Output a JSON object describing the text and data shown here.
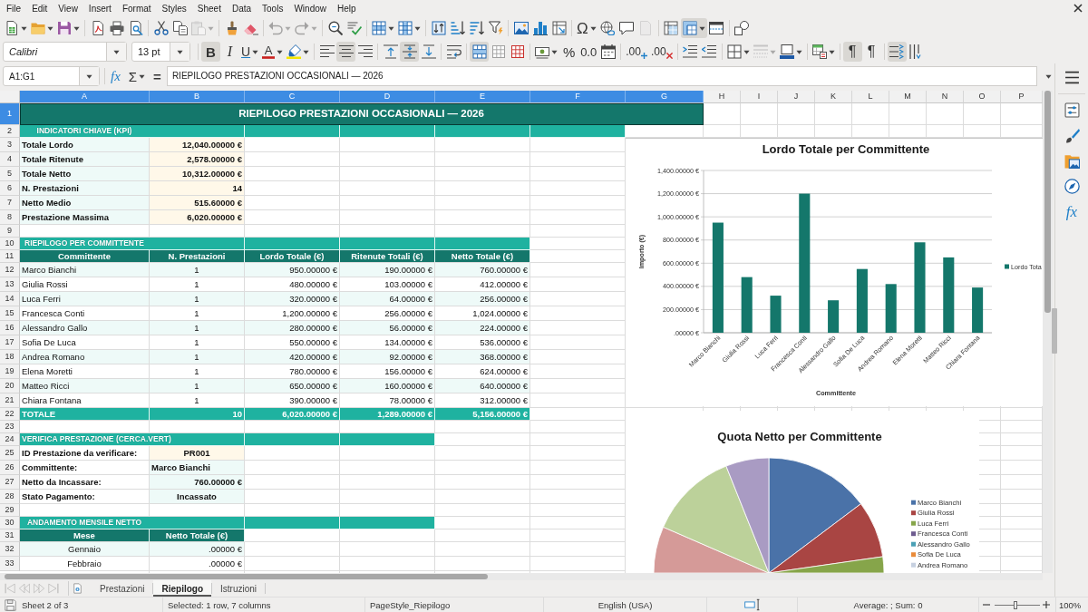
{
  "menu": [
    "File",
    "Edit",
    "View",
    "Insert",
    "Format",
    "Styles",
    "Sheet",
    "Data",
    "Tools",
    "Window",
    "Help"
  ],
  "standard_toolbar": [
    [
      {
        "kind": "new",
        "active": false,
        "disabled": false,
        "dropdown": true
      },
      {
        "kind": "open",
        "active": false,
        "disabled": false,
        "dropdown": true
      },
      {
        "kind": "save",
        "active": false,
        "disabled": false,
        "dropdown": true
      }
    ],
    [
      {
        "kind": "pdf",
        "active": false,
        "disabled": false
      },
      {
        "kind": "print",
        "active": false,
        "disabled": false
      },
      {
        "kind": "preview",
        "active": false,
        "disabled": false
      }
    ],
    [
      {
        "kind": "cut",
        "active": false,
        "disabled": false
      },
      {
        "kind": "copy",
        "active": false,
        "disabled": false
      },
      {
        "kind": "paste",
        "active": false,
        "disabled": true,
        "dropdown": true
      }
    ],
    [
      {
        "kind": "clone",
        "active": false,
        "disabled": false
      },
      {
        "kind": "clear",
        "active": false,
        "disabled": false
      }
    ],
    [
      {
        "kind": "undo",
        "active": false,
        "disabled": true,
        "dropdown": true
      },
      {
        "kind": "redo",
        "active": false,
        "disabled": true,
        "dropdown": true
      }
    ],
    [
      {
        "kind": "find",
        "active": false,
        "disabled": false
      },
      {
        "kind": "spell",
        "active": false,
        "disabled": false
      }
    ],
    [
      {
        "kind": "row",
        "active": false,
        "disabled": false,
        "dropdown": true
      },
      {
        "kind": "column",
        "active": false,
        "disabled": false,
        "dropdown": true
      }
    ],
    [
      {
        "kind": "sort",
        "active": false,
        "disabled": false
      },
      {
        "kind": "sort_ascending",
        "active": false,
        "disabled": false
      },
      {
        "kind": "sort_descending",
        "active": false,
        "disabled": false
      },
      {
        "kind": "autofilter",
        "active": false,
        "disabled": false
      }
    ],
    [
      {
        "kind": "image",
        "active": false,
        "disabled": false
      },
      {
        "kind": "chart",
        "active": false,
        "disabled": false
      },
      {
        "kind": "pivot_table",
        "active": false,
        "disabled": false
      }
    ],
    [
      {
        "kind": "special_character",
        "glyph": "Ω",
        "active": false,
        "disabled": false,
        "dropdown": true
      },
      {
        "kind": "hyperlink",
        "active": false,
        "disabled": false
      },
      {
        "kind": "comment",
        "active": false,
        "disabled": false
      },
      {
        "kind": "headers_footers",
        "active": false,
        "disabled": true
      }
    ],
    [
      {
        "kind": "print_area",
        "active": false,
        "disabled": false
      },
      {
        "kind": "freeze",
        "active": true,
        "disabled": false,
        "dropdown": true
      },
      {
        "kind": "split_window",
        "active": false,
        "disabled": false
      }
    ],
    [
      {
        "kind": "shapes",
        "active": false,
        "disabled": false
      }
    ]
  ],
  "formatting_toolbar": [
    [
      {
        "kind": "font_name",
        "value": "Calibri",
        "disabled": false
      },
      {
        "kind": "font_size",
        "value": "13 pt",
        "disabled": false
      }
    ],
    [
      {
        "kind": "bold",
        "glyph": "B",
        "active": true,
        "disabled": false
      },
      {
        "kind": "italic",
        "glyph": "I",
        "active": false,
        "disabled": false
      },
      {
        "kind": "underline",
        "glyph": "U",
        "active": false,
        "disabled": false,
        "dropdown": true
      },
      {
        "kind": "font_color",
        "glyph": "A",
        "active": false,
        "disabled": false,
        "dropdown": true
      },
      {
        "kind": "highlight",
        "active": false,
        "disabled": false,
        "dropdown": true
      }
    ],
    [
      {
        "kind": "align_left",
        "active": false,
        "disabled": false
      },
      {
        "kind": "align_center",
        "active": true,
        "disabled": false
      },
      {
        "kind": "align_right",
        "active": false,
        "disabled": false
      }
    ],
    [
      {
        "kind": "align_top",
        "active": false,
        "disabled": false
      },
      {
        "kind": "align_middle",
        "active": true,
        "disabled": false
      },
      {
        "kind": "align_bottom",
        "active": false,
        "disabled": false
      }
    ],
    [
      {
        "kind": "wrap",
        "active": false,
        "disabled": false
      }
    ],
    [
      {
        "kind": "merge_center",
        "active": true,
        "disabled": false
      },
      {
        "kind": "unmerge",
        "active": false,
        "disabled": false
      },
      {
        "kind": "merge",
        "active": false,
        "disabled": false
      }
    ],
    [
      {
        "kind": "currency",
        "active": false,
        "disabled": false,
        "dropdown": true
      },
      {
        "kind": "percent",
        "glyph": "%",
        "active": false,
        "disabled": false
      },
      {
        "kind": "number",
        "glyph": "0.0",
        "active": false,
        "disabled": false
      },
      {
        "kind": "date",
        "active": false,
        "disabled": false
      }
    ],
    [
      {
        "kind": "add_decimal",
        "glyph": ".00",
        "active": false,
        "disabled": false
      },
      {
        "kind": "delete_decimal",
        "glyph": ".00",
        "active": false,
        "disabled": false
      }
    ],
    [
      {
        "kind": "indent",
        "active": false,
        "disabled": false
      },
      {
        "kind": "outdent",
        "active": false,
        "disabled": false
      }
    ],
    [
      {
        "kind": "borders",
        "active": false,
        "disabled": false,
        "dropdown": true
      },
      {
        "kind": "border_style",
        "active": false,
        "disabled": true,
        "dropdown": true
      },
      {
        "kind": "border_color",
        "active": false,
        "disabled": false,
        "dropdown": true
      }
    ],
    [
      {
        "kind": "conditional",
        "active": false,
        "disabled": false,
        "dropdown": true
      }
    ],
    [
      {
        "kind": "left_to_right",
        "glyph": "¶",
        "active": true,
        "disabled": false
      },
      {
        "kind": "right_to_left",
        "glyph": "¶",
        "active": false,
        "disabled": false
      }
    ],
    [
      {
        "kind": "text_direction",
        "active": true,
        "disabled": false
      },
      {
        "kind": "vertical_text",
        "active": false,
        "disabled": false
      }
    ]
  ],
  "formula_bar": {
    "name_box": "A1:G1",
    "function_wizard": "fx",
    "sum": "Σ",
    "equals": "=",
    "formula": "RIEPILOGO PRESTAZIONI OCCASIONALI — 2026"
  },
  "columns": [
    {
      "label": "A",
      "selected": true
    },
    {
      "label": "B",
      "selected": true
    },
    {
      "label": "C",
      "selected": true
    },
    {
      "label": "D",
      "selected": true
    },
    {
      "label": "E",
      "selected": true
    },
    {
      "label": "F",
      "selected": true
    },
    {
      "label": "G",
      "selected": true
    },
    {
      "label": "H",
      "selected": false
    },
    {
      "label": "I",
      "selected": false
    },
    {
      "label": "J",
      "selected": false
    },
    {
      "label": "K",
      "selected": false
    },
    {
      "label": "L",
      "selected": false
    },
    {
      "label": "M",
      "selected": false
    },
    {
      "label": "N",
      "selected": false
    },
    {
      "label": "O",
      "selected": false
    },
    {
      "label": "P",
      "selected": false
    }
  ],
  "rows": [
    {
      "label": "1",
      "selected": true,
      "kind": "title",
      "cells": [
        {
          "kind": "title",
          "text": "RIEPILOGO PRESTAZIONI OCCASIONALI — 2026"
        }
      ]
    },
    {
      "label": "2",
      "selected": false,
      "kind": "section",
      "cells": [
        {
          "kind": "section",
          "text": "INDICATORI CHIAVE (KPI)"
        },
        {
          "kind": "section"
        },
        {
          "kind": "section"
        },
        {
          "kind": "section"
        },
        {
          "kind": "section"
        },
        {
          "kind": "section"
        }
      ]
    },
    {
      "label": "3",
      "selected": false,
      "kind": "data",
      "cells": [
        {
          "kind": "kpi_label",
          "text": "Totale Lordo"
        },
        {
          "kind": "kpi_value",
          "text": "12,040.00000 €"
        }
      ]
    },
    {
      "label": "4",
      "selected": false,
      "kind": "data",
      "cells": [
        {
          "kind": "kpi_label",
          "text": "Totale Ritenute"
        },
        {
          "kind": "kpi_value",
          "text": "2,578.00000 €"
        }
      ]
    },
    {
      "label": "5",
      "selected": false,
      "kind": "data",
      "cells": [
        {
          "kind": "kpi_label",
          "text": "Totale Netto"
        },
        {
          "kind": "kpi_value",
          "text": "10,312.00000 €"
        }
      ]
    },
    {
      "label": "6",
      "selected": false,
      "kind": "data",
      "cells": [
        {
          "kind": "kpi_label",
          "text": "N. Prestazioni"
        },
        {
          "kind": "kpi_value",
          "text": "14"
        }
      ]
    },
    {
      "label": "7",
      "selected": false,
      "kind": "data",
      "cells": [
        {
          "kind": "kpi_label",
          "text": "Netto Medio"
        },
        {
          "kind": "kpi_value",
          "text": "515.60000 €"
        }
      ]
    },
    {
      "label": "8",
      "selected": false,
      "kind": "data",
      "cells": [
        {
          "kind": "kpi_label",
          "text": "Prestazione Massima"
        },
        {
          "kind": "kpi_value",
          "text": "6,020.00000 €"
        }
      ]
    },
    {
      "label": "9",
      "selected": false,
      "kind": "blank"
    },
    {
      "label": "10",
      "selected": false,
      "kind": "section",
      "cells": [
        {
          "kind": "section",
          "text": "RIEPILOGO PER COMMITTENTE"
        },
        {
          "kind": "section"
        },
        {
          "kind": "section"
        },
        {
          "kind": "section"
        },
        {
          "kind": "section"
        }
      ]
    },
    {
      "label": "11",
      "selected": false,
      "kind": "header",
      "cells": [
        {
          "kind": "header",
          "text": "Committente"
        },
        {
          "kind": "header",
          "text": "N. Prestazioni"
        },
        {
          "kind": "header",
          "text": "Lordo Totale (€)"
        },
        {
          "kind": "header",
          "text": "Ritenute Totali (€)"
        },
        {
          "kind": "header",
          "text": "Netto Totale (€)"
        }
      ]
    },
    {
      "label": "12",
      "selected": false,
      "kind": "data",
      "shaded": true,
      "cells": [
        {
          "kind": "name",
          "text": "Marco Bianchi"
        },
        {
          "kind": "count",
          "text": "1"
        },
        {
          "kind": "amount",
          "text": "950.00000 €"
        },
        {
          "kind": "amount",
          "text": "190.00000 €"
        },
        {
          "kind": "amount",
          "text": "760.00000 €"
        }
      ]
    },
    {
      "label": "13",
      "selected": false,
      "kind": "data",
      "shaded": false,
      "cells": [
        {
          "kind": "name",
          "text": "Giulia Rossi"
        },
        {
          "kind": "count",
          "text": "1"
        },
        {
          "kind": "amount",
          "text": "480.00000 €"
        },
        {
          "kind": "amount",
          "text": "103.00000 €"
        },
        {
          "kind": "amount",
          "text": "412.00000 €"
        }
      ]
    },
    {
      "label": "14",
      "selected": false,
      "kind": "data",
      "shaded": true,
      "cells": [
        {
          "kind": "name",
          "text": "Luca Ferri"
        },
        {
          "kind": "count",
          "text": "1"
        },
        {
          "kind": "amount",
          "text": "320.00000 €"
        },
        {
          "kind": "amount",
          "text": "64.00000 €"
        },
        {
          "kind": "amount",
          "text": "256.00000 €"
        }
      ]
    },
    {
      "label": "15",
      "selected": false,
      "kind": "data",
      "shaded": false,
      "cells": [
        {
          "kind": "name",
          "text": "Francesca Conti"
        },
        {
          "kind": "count",
          "text": "1"
        },
        {
          "kind": "amount",
          "text": "1,200.00000 €"
        },
        {
          "kind": "amount",
          "text": "256.00000 €"
        },
        {
          "kind": "amount",
          "text": "1,024.00000 €"
        }
      ]
    },
    {
      "label": "16",
      "selected": false,
      "kind": "data",
      "shaded": true,
      "cells": [
        {
          "kind": "name",
          "text": "Alessandro Gallo"
        },
        {
          "kind": "count",
          "text": "1"
        },
        {
          "kind": "amount",
          "text": "280.00000 €"
        },
        {
          "kind": "amount",
          "text": "56.00000 €"
        },
        {
          "kind": "amount",
          "text": "224.00000 €"
        }
      ]
    },
    {
      "label": "17",
      "selected": false,
      "kind": "data",
      "shaded": false,
      "cells": [
        {
          "kind": "name",
          "text": "Sofia De Luca"
        },
        {
          "kind": "count",
          "text": "1"
        },
        {
          "kind": "amount",
          "text": "550.00000 €"
        },
        {
          "kind": "amount",
          "text": "134.00000 €"
        },
        {
          "kind": "amount",
          "text": "536.00000 €"
        }
      ]
    },
    {
      "label": "18",
      "selected": false,
      "kind": "data",
      "shaded": true,
      "cells": [
        {
          "kind": "name",
          "text": "Andrea Romano"
        },
        {
          "kind": "count",
          "text": "1"
        },
        {
          "kind": "amount",
          "text": "420.00000 €"
        },
        {
          "kind": "amount",
          "text": "92.00000 €"
        },
        {
          "kind": "amount",
          "text": "368.00000 €"
        }
      ]
    },
    {
      "label": "19",
      "selected": false,
      "kind": "data",
      "shaded": false,
      "cells": [
        {
          "kind": "name",
          "text": "Elena Moretti"
        },
        {
          "kind": "count",
          "text": "1"
        },
        {
          "kind": "amount",
          "text": "780.00000 €"
        },
        {
          "kind": "amount",
          "text": "156.00000 €"
        },
        {
          "kind": "amount",
          "text": "624.00000 €"
        }
      ]
    },
    {
      "label": "20",
      "selected": false,
      "kind": "data",
      "shaded": true,
      "cells": [
        {
          "kind": "name",
          "text": "Matteo Ricci"
        },
        {
          "kind": "count",
          "text": "1"
        },
        {
          "kind": "amount",
          "text": "650.00000 €"
        },
        {
          "kind": "amount",
          "text": "160.00000 €"
        },
        {
          "kind": "amount",
          "text": "640.00000 €"
        }
      ]
    },
    {
      "label": "21",
      "selected": false,
      "kind": "data",
      "shaded": false,
      "cells": [
        {
          "kind": "name",
          "text": "Chiara Fontana"
        },
        {
          "kind": "count",
          "text": "1"
        },
        {
          "kind": "amount",
          "text": "390.00000 €"
        },
        {
          "kind": "amount",
          "text": "78.00000 €"
        },
        {
          "kind": "amount",
          "text": "312.00000 €"
        }
      ]
    },
    {
      "label": "22",
      "selected": false,
      "kind": "total",
      "cells": [
        {
          "kind": "total_label",
          "text": "TOTALE"
        },
        {
          "kind": "total_value",
          "text": "10"
        },
        {
          "kind": "total_value",
          "text": "6,020.00000 €"
        },
        {
          "kind": "total_value",
          "text": "1,289.00000 €"
        },
        {
          "kind": "total_value",
          "text": "5,156.00000 €"
        }
      ]
    },
    {
      "label": "23",
      "selected": false,
      "kind": "blank"
    },
    {
      "label": "24",
      "selected": false,
      "kind": "section",
      "cells": [
        {
          "kind": "section",
          "text": "VERIFICA PRESTAZIONE (CERCA.VERT)"
        },
        {
          "kind": "section"
        },
        {
          "kind": "section"
        },
        {
          "kind": "section"
        }
      ]
    },
    {
      "label": "25",
      "selected": false,
      "kind": "data",
      "cells": [
        {
          "kind": "field_label",
          "text": "ID Prestazione da verificare:"
        },
        {
          "kind": "input",
          "text": "PR001"
        }
      ]
    },
    {
      "label": "26",
      "selected": false,
      "kind": "data",
      "cells": [
        {
          "kind": "field_label",
          "text": "Committente:"
        },
        {
          "kind": "lookup_text",
          "text": "Marco Bianchi"
        }
      ]
    },
    {
      "label": "27",
      "selected": false,
      "kind": "data",
      "cells": [
        {
          "kind": "field_label",
          "text": "Netto da Incassare:"
        },
        {
          "kind": "lookup_amount",
          "text": "760.00000 €"
        }
      ]
    },
    {
      "label": "28",
      "selected": false,
      "kind": "data",
      "cells": [
        {
          "kind": "field_label",
          "text": "Stato Pagamento:"
        },
        {
          "kind": "lookup_status",
          "text": "Incassato"
        }
      ]
    },
    {
      "label": "29",
      "selected": false,
      "kind": "blank"
    },
    {
      "label": "30",
      "selected": false,
      "kind": "section",
      "cells": [
        {
          "kind": "section",
          "text": "ANDAMENTO MENSILE NETTO"
        },
        {
          "kind": "section"
        },
        {
          "kind": "section"
        },
        {
          "kind": "section"
        }
      ]
    },
    {
      "label": "31",
      "selected": false,
      "kind": "header",
      "cells": [
        {
          "kind": "header",
          "text": "Mese"
        },
        {
          "kind": "header",
          "text": "Netto Totale (€)"
        }
      ]
    },
    {
      "label": "32",
      "selected": false,
      "kind": "data",
      "shaded": true,
      "cells": [
        {
          "kind": "month",
          "text": "Gennaio"
        },
        {
          "kind": "amount",
          "text": ".00000 €"
        }
      ]
    },
    {
      "label": "33",
      "selected": false,
      "kind": "data",
      "shaded": false,
      "cells": [
        {
          "kind": "month",
          "text": "Febbraio"
        },
        {
          "kind": "amount",
          "text": ".00000 €"
        }
      ]
    }
  ],
  "charts": [
    {
      "kind": "bar_chart",
      "chart_data": {
        "type": "bar",
        "title": "Lordo Totale per Committente",
        "xlabel": "Committente",
        "ylabel": "Importo (€)",
        "categories": [
          "Marco Bianchi",
          "Giulia Rossi",
          "Luca Ferri",
          "Francesca Conti",
          "Alessandro Gallo",
          "Sofia De Luca",
          "Andrea Romano",
          "Elena Moretti",
          "Matteo Ricci",
          "Chiara Fontana"
        ],
        "series": [
          {
            "name": "Lordo Tota",
            "color": "#14776b",
            "values": [
              950,
              480,
              320,
              1200,
              280,
              550,
              420,
              780,
              650,
              390
            ]
          }
        ],
        "ylim": [
          0,
          1400
        ],
        "yticks": [
          {
            "value": 0,
            "label": ".00000 €"
          },
          {
            "value": 200,
            "label": "200.00000 €"
          },
          {
            "value": 400,
            "label": "400.00000 €"
          },
          {
            "value": 600,
            "label": "600.00000 €"
          },
          {
            "value": 800,
            "label": "800.00000 €"
          },
          {
            "value": 1000,
            "label": "1,000.00000 €"
          },
          {
            "value": 1200,
            "label": "1,200.00000 €"
          },
          {
            "value": 1400,
            "label": "1,400.00000 €"
          }
        ],
        "grid": true
      }
    },
    {
      "kind": "pie_chart",
      "title": "Quota Netto per Committente",
      "legend": [
        {
          "label": "Marco Bianchi",
          "color": "#4a72a8"
        },
        {
          "label": "Giulia Rossi",
          "color": "#a94543"
        },
        {
          "label": "Luca Ferri",
          "color": "#86a54a"
        },
        {
          "label": "Francesca Conti",
          "color": "#6d5b8f"
        },
        {
          "label": "Alessandro Gallo",
          "color": "#4aa0b5"
        },
        {
          "label": "Sofia De Luca",
          "color": "#e98b3a"
        },
        {
          "label": "Andrea Romano",
          "color": "#c6d0e0"
        }
      ]
    }
  ],
  "sheet_nav": [
    {
      "kind": "first",
      "disabled": true
    },
    {
      "kind": "previous",
      "disabled": true
    },
    {
      "kind": "next",
      "disabled": true
    },
    {
      "kind": "last",
      "disabled": true
    }
  ],
  "sheet_tabs": [
    {
      "label": "Prestazioni",
      "selected": false
    },
    {
      "label": "Riepilogo",
      "selected": true
    },
    {
      "label": "Istruzioni",
      "selected": false
    }
  ],
  "sidebar_tabs": [
    {
      "kind": "properties"
    },
    {
      "kind": "styles"
    },
    {
      "kind": "gallery"
    },
    {
      "kind": "navigator"
    },
    {
      "kind": "functions",
      "glyph": "fx"
    }
  ],
  "status_bar": {
    "sheet": "Sheet 2 of 3",
    "selection": "Selected: 1 row, 7 columns",
    "page_style": "PageStyle_Riepilogo",
    "language": "English (USA)",
    "summary": "Average: ; Sum: 0",
    "zoom_slider": {
      "level": 0.45
    },
    "zoom": "100%"
  }
}
